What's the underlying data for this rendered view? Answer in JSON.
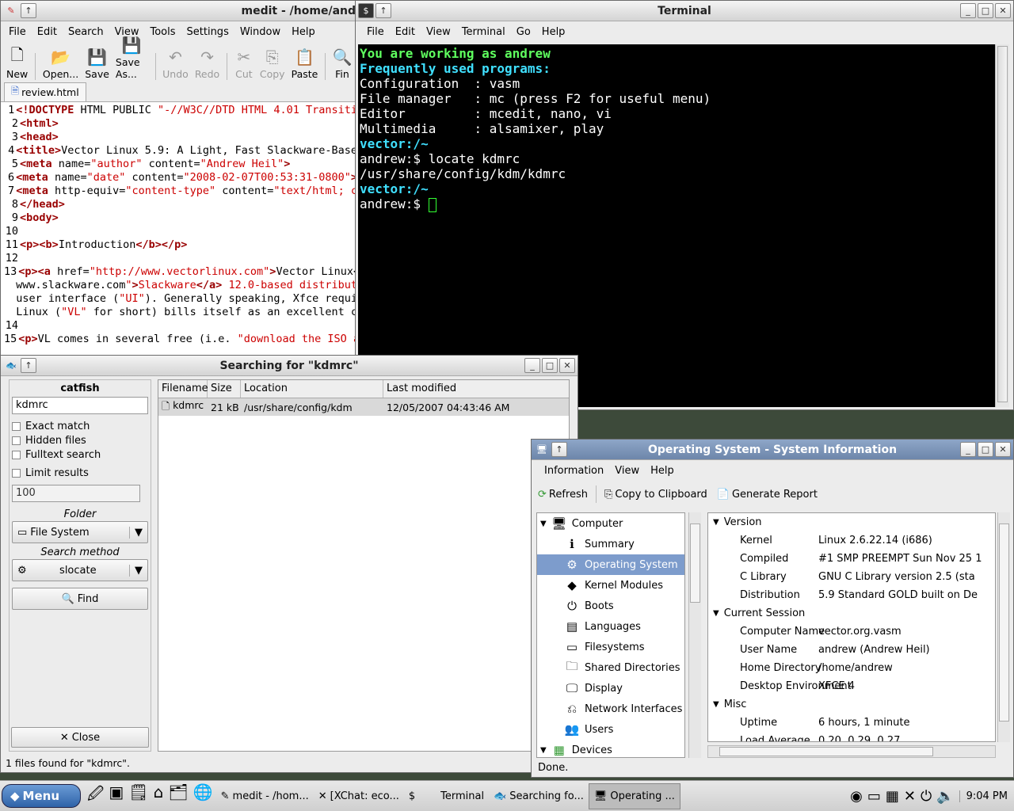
{
  "medit": {
    "title": "medit - /home/and",
    "menus": [
      "File",
      "Edit",
      "Search",
      "View",
      "Tools",
      "Settings",
      "Window",
      "Help"
    ],
    "tools": {
      "new": "New",
      "open": "Open...",
      "save": "Save",
      "saveas": "Save As...",
      "undo": "Undo",
      "redo": "Redo",
      "cut": "Cut",
      "copy": "Copy",
      "paste": "Paste",
      "find": "Fin"
    },
    "tab": "review.html",
    "lines": [
      {
        "n": "1",
        "t": "<!DOCTYPE HTML PUBLIC \"-//W3C//DTD HTML 4.01 Transiti"
      },
      {
        "n": "2",
        "t": "<html>"
      },
      {
        "n": "3",
        "t": "<head>"
      },
      {
        "n": "4",
        "t": "<title>Vector Linux 5.9: A Light, Fast Slackware-Base"
      },
      {
        "n": "5",
        "t": "<meta name=\"author\" content=\"Andrew Heil\">"
      },
      {
        "n": "6",
        "t": "<meta name=\"date\" content=\"2008-02-07T00:53:31-0800\">"
      },
      {
        "n": "7",
        "t": "<meta http-equiv=\"content-type\" content=\"text/html; c"
      },
      {
        "n": "8",
        "t": "</head>"
      },
      {
        "n": "9",
        "t": "<body>"
      },
      {
        "n": "10",
        "t": ""
      },
      {
        "n": "11",
        "t": "<p><b>Introduction</b></p>"
      },
      {
        "n": "12",
        "t": ""
      },
      {
        "n": "13",
        "t": "<p><a href=\"http://www.vectorlinux.com\">Vector Linux<"
      },
      {
        "n": "",
        "t": "www.slackware.com\">Slackware</a> 12.0-based distribut"
      },
      {
        "n": "",
        "t": "user interface (\"UI\"). Generally speaking, Xfce requi"
      },
      {
        "n": "",
        "t": "Linux (\"VL\" for short) bills itself as an excellent c"
      },
      {
        "n": "14",
        "t": ""
      },
      {
        "n": "15",
        "t": "<p>VL comes in several free (i.e. \"download the ISO a"
      }
    ]
  },
  "terminal": {
    "title": "Terminal",
    "menus": [
      "File",
      "Edit",
      "View",
      "Terminal",
      "Go",
      "Help"
    ],
    "lines": [
      {
        "t": "You are working as andrew",
        "s": "g"
      },
      {
        "t": "Frequently used programs:",
        "s": "c"
      },
      {
        "t": "Configuration  : vasm",
        "s": ""
      },
      {
        "t": "File manager   : mc (press F2 for useful menu)",
        "s": ""
      },
      {
        "t": "Editor         : mcedit, nano, vi",
        "s": ""
      },
      {
        "t": "Multimedia     : alsamixer, play",
        "s": ""
      },
      {
        "t": "vector:/~",
        "s": "c"
      },
      {
        "t": "andrew:$ locate kdmrc",
        "s": ""
      },
      {
        "t": "/usr/share/config/kdm/kdmrc",
        "s": ""
      },
      {
        "t": "vector:/~",
        "s": "c"
      },
      {
        "t": "andrew:$ ",
        "s": ""
      }
    ]
  },
  "catfish": {
    "title": "Searching for \"kdmrc\"",
    "app": "catfish",
    "query": "kdmrc",
    "exact": "Exact match",
    "hidden": "Hidden files",
    "fulltext": "Fulltext search",
    "limit": "Limit results",
    "limit_value": "100",
    "folder_label": "Folder",
    "folder": "File System",
    "method_label": "Search method",
    "method": "slocate",
    "find": "Find",
    "close": "Close",
    "columns": [
      "Filename",
      "Size",
      "Location",
      "Last modified"
    ],
    "row": {
      "name": "kdmrc",
      "size": "21 kB",
      "location": "/usr/share/config/kdm",
      "modified": "12/05/2007 04:43:46 AM"
    },
    "status": "1 files found for \"kdmrc\"."
  },
  "sysinfo": {
    "title": "Operating System - System Information",
    "menus": [
      "Information",
      "View",
      "Help"
    ],
    "refresh": "Refresh",
    "copy": "Copy to Clipboard",
    "report": "Generate Report",
    "tree": {
      "computer": "Computer",
      "items": [
        "Summary",
        "Operating System",
        "Kernel Modules",
        "Boots",
        "Languages",
        "Filesystems",
        "Shared Directories",
        "Display",
        "Network Interfaces",
        "Users"
      ],
      "devices": "Devices"
    },
    "sections": [
      {
        "name": "Version",
        "rows": [
          [
            "Kernel",
            "Linux 2.6.22.14 (i686)"
          ],
          [
            "Compiled",
            "#1 SMP PREEMPT Sun Nov 25 1"
          ],
          [
            "C Library",
            "GNU C Library version 2.5 (sta"
          ],
          [
            "Distribution",
            "5.9 Standard GOLD built on De"
          ]
        ]
      },
      {
        "name": "Current Session",
        "rows": [
          [
            "Computer Name",
            "vector.org.vasm"
          ],
          [
            "User Name",
            "andrew (Andrew Heil)"
          ],
          [
            "Home Directory",
            "/home/andrew"
          ],
          [
            "Desktop Environment",
            "XFCE 4"
          ]
        ]
      },
      {
        "name": "Misc",
        "rows": [
          [
            "Uptime",
            "6 hours, 1 minute"
          ],
          [
            "Load Average",
            "0.20, 0.29, 0.27"
          ]
        ]
      }
    ],
    "status": "Done."
  },
  "taskbar": {
    "menu": "Menu",
    "tasks": [
      "medit - /hom...",
      "[XChat: eco...",
      "Terminal",
      "Searching fo...",
      "Operating ..."
    ],
    "clock": "9:04 PM"
  },
  "colors": {
    "accent": "#6d86aa",
    "selection": "#7d9ccc",
    "term_green": "#5fff5f",
    "term_cyan": "#40e0ff"
  }
}
